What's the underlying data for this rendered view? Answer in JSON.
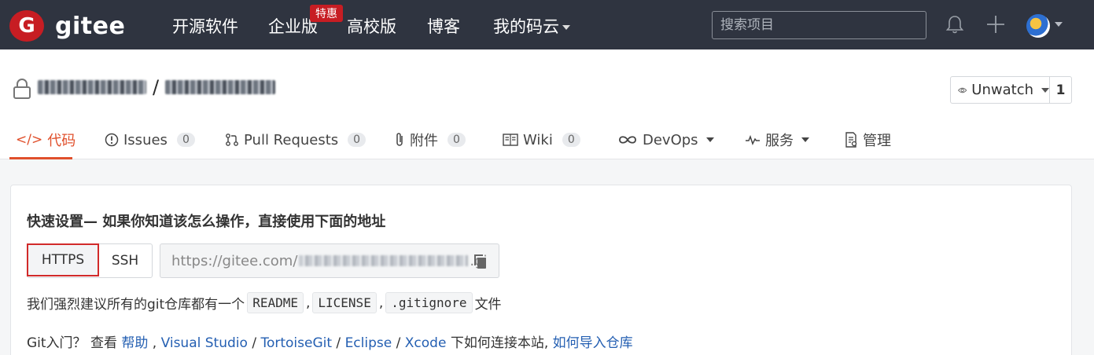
{
  "topbar": {
    "logo_mark": "G",
    "logo_text": "gitee",
    "nav": [
      "开源软件",
      "企业版",
      "高校版",
      "博客",
      "我的码云"
    ],
    "badge": "特惠",
    "search_placeholder": "搜索项目"
  },
  "repo": {
    "separator": "/",
    "watch_label": "Unwatch",
    "watch_count": "1"
  },
  "tabs": [
    {
      "label": "代码"
    },
    {
      "label": "Issues",
      "count": "0"
    },
    {
      "label": "Pull Requests",
      "count": "0"
    },
    {
      "label": "附件",
      "count": "0"
    },
    {
      "label": "Wiki",
      "count": "0"
    },
    {
      "label": "DevOps"
    },
    {
      "label": "服务"
    },
    {
      "label": "管理"
    }
  ],
  "quick_setup": {
    "title": "快速设置— 如果你知道该怎么操作，直接使用下面的地址",
    "https_label": "HTTPS",
    "ssh_label": "SSH",
    "url_prefix": "https://gitee.com/",
    "url_suffix": ".gi",
    "advice_prefix": "我们强烈建议所有的git仓库都有一个",
    "readme": "README",
    "license": "LICENSE",
    "gitignore": ".gitignore",
    "advice_suffix": "文件",
    "comma": ",",
    "help_prefix": "Git入门？ 查看 ",
    "help_link": "帮助",
    "vs_link": "Visual Studio",
    "tortoise_link": "TortoiseGit",
    "eclipse_link": "Eclipse",
    "xcode_link": "Xcode",
    "help_middle": " 下如何连接本站, ",
    "import_link": "如何导入仓库"
  },
  "colors": {
    "accent": "#e0502c",
    "brand": "#c71d23",
    "link": "#245fb2"
  }
}
